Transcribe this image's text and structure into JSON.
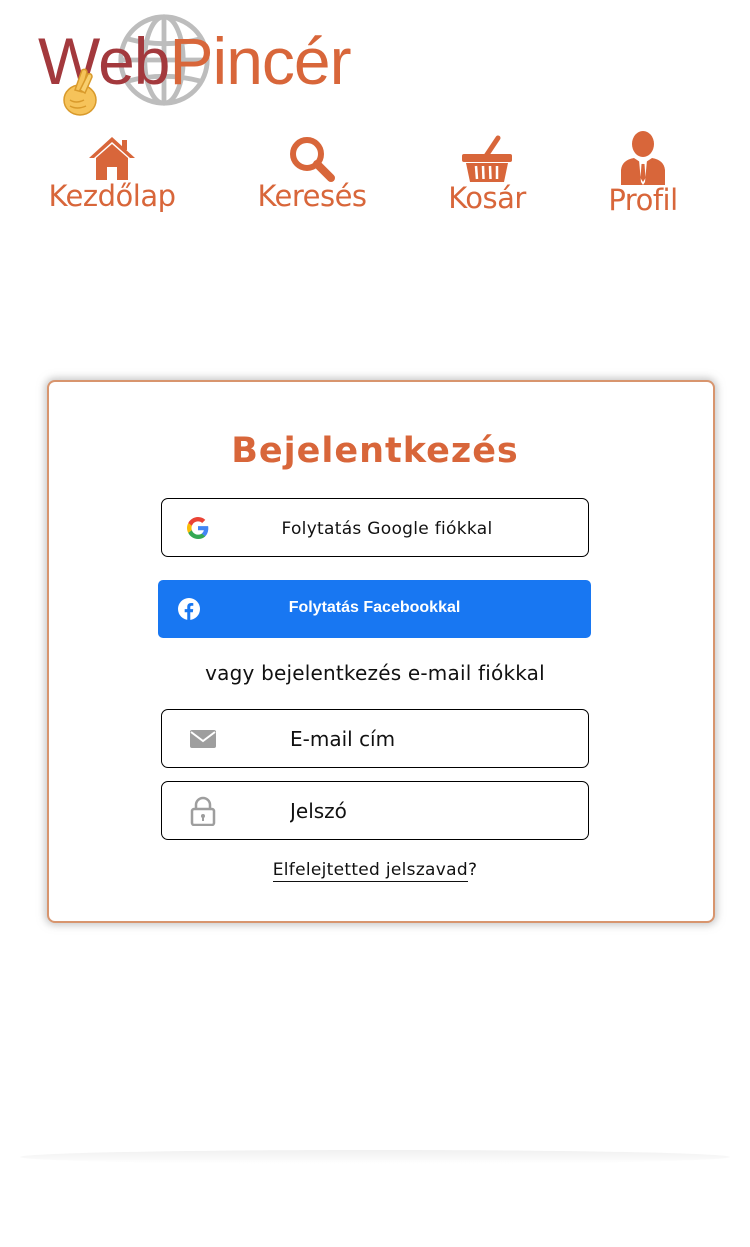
{
  "logo": {
    "part1": "Web",
    "part2": "Pincér",
    "icons": [
      "globe-icon",
      "crossed-fingers-icon"
    ]
  },
  "nav": {
    "items": [
      {
        "label": "Kezdőlap",
        "icon": "home-icon"
      },
      {
        "label": "Keresés",
        "icon": "search-icon"
      },
      {
        "label": "Kosár",
        "icon": "basket-icon"
      },
      {
        "label": "Profil",
        "icon": "user-icon"
      }
    ]
  },
  "login": {
    "title": "Bejelentkezés",
    "google_label": "Folytatás Google fiókkal",
    "facebook_label": "Folytatás Facebookkal",
    "divider": "vagy bejelentkezés e-mail fiókkal",
    "email_placeholder": "E-mail cím",
    "password_placeholder": "Jelszó",
    "forgot_link": "Elfelejtetted jelszavad",
    "forgot_suffix": "?"
  },
  "colors": {
    "accent": "#d8663a",
    "logo_dark": "#a3393d",
    "facebook": "#1877f2",
    "card_border": "#d8956e"
  }
}
